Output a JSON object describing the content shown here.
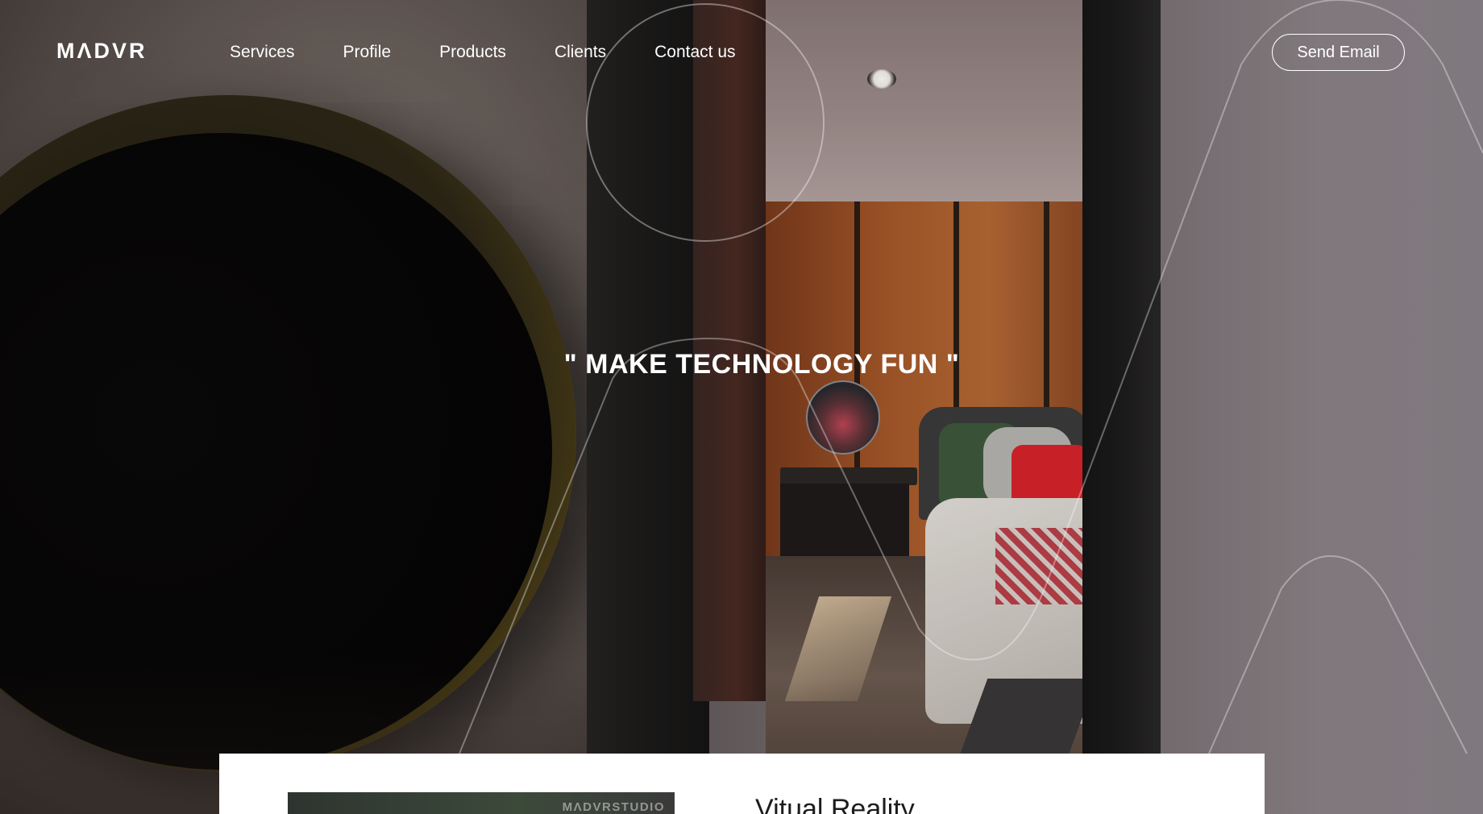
{
  "brand": {
    "logo": "MΛDVR"
  },
  "nav": {
    "items": [
      {
        "label": "Services"
      },
      {
        "label": "Profile"
      },
      {
        "label": "Products"
      },
      {
        "label": "Clients"
      },
      {
        "label": "Contact us"
      }
    ],
    "cta_label": "Send Email"
  },
  "hero": {
    "tagline": "\" MAKE TECHNOLOGY FUN \""
  },
  "feature": {
    "thumb_label": "MΛDVRSTUDIO",
    "title": "Vitual Reality"
  },
  "colors": {
    "text": "#ffffff",
    "card_background": "#ffffff",
    "card_title": "#1c1c1c"
  }
}
